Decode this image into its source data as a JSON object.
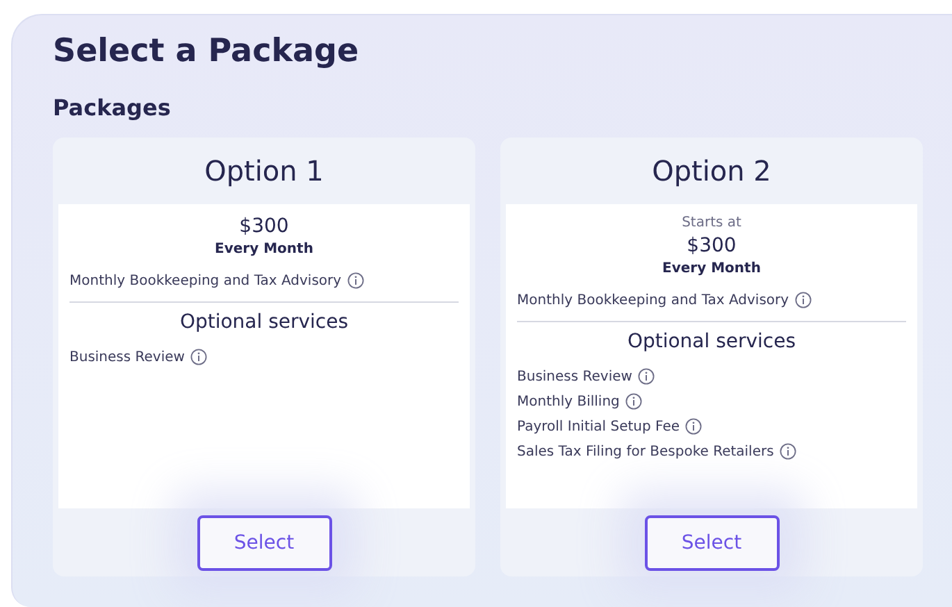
{
  "title": "Select a Package",
  "section": "Packages",
  "packages": [
    {
      "name": "Option 1",
      "price": "$300",
      "period": "Every Month",
      "included": [
        "Monthly Bookkeeping and Tax Advisory"
      ],
      "optional_title": "Optional services",
      "optional": [
        "Business Review"
      ],
      "button": "Select"
    },
    {
      "name": "Option 2",
      "prefix": "Starts at",
      "price": "$300",
      "period": "Every Month",
      "included": [
        "Monthly Bookkeeping and Tax Advisory"
      ],
      "optional_title": "Optional services",
      "optional": [
        "Business Review",
        "Monthly Billing",
        "Payroll Initial Setup Fee",
        "Sales Tax Filing for Bespoke Retailers"
      ],
      "button": "Select"
    }
  ]
}
